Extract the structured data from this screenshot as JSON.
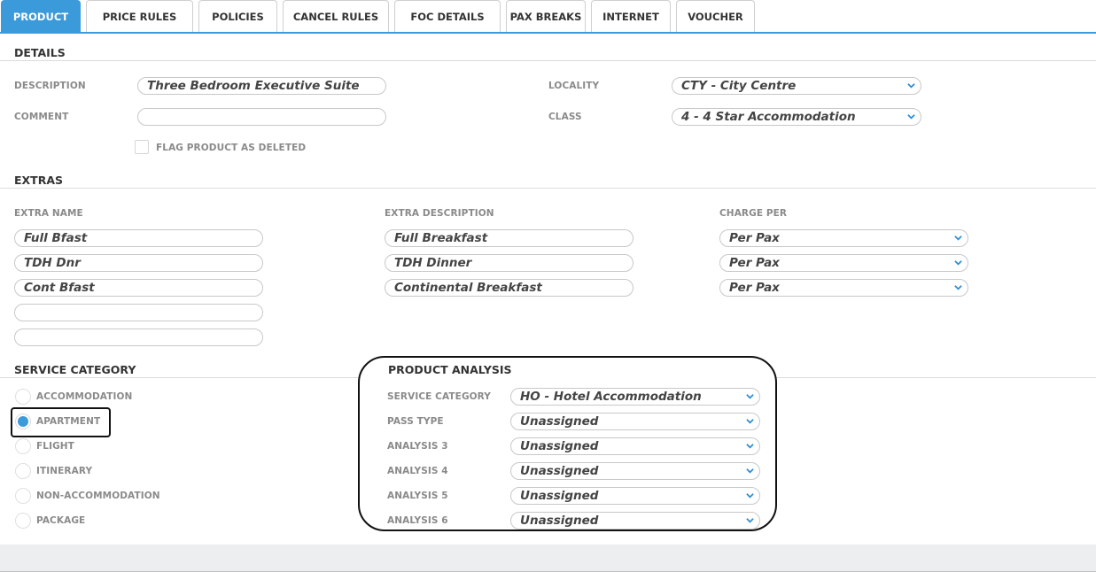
{
  "tabs": [
    {
      "label": "PRODUCT",
      "active": true
    },
    {
      "label": "PRICE RULES"
    },
    {
      "label": "POLICIES"
    },
    {
      "label": "CANCEL RULES"
    },
    {
      "label": "FOC DETAILS"
    },
    {
      "label": "PAX BREAKS"
    },
    {
      "label": "INTERNET"
    },
    {
      "label": "VOUCHER"
    }
  ],
  "details": {
    "title": "DETAILS",
    "description_label": "DESCRIPTION",
    "description_value": "Three Bedroom Executive Suite",
    "comment_label": "COMMENT",
    "comment_value": "",
    "flag_deleted_label": "FLAG PRODUCT AS DELETED",
    "flag_deleted_checked": false,
    "locality_label": "LOCALITY",
    "locality_value": "CTY - City Centre",
    "class_label": "CLASS",
    "class_value": "4 - 4 Star Accommodation"
  },
  "extras": {
    "title": "EXTRAS",
    "col_name": "EXTRA NAME",
    "col_description": "EXTRA DESCRIPTION",
    "col_charge": "CHARGE PER",
    "rows": [
      {
        "name": "Full Bfast",
        "description": "Full Breakfast",
        "charge": "Per Pax"
      },
      {
        "name": "TDH Dnr",
        "description": "TDH Dinner",
        "charge": "Per Pax"
      },
      {
        "name": "Cont Bfast",
        "description": "Continental Breakfast",
        "charge": "Per Pax"
      },
      {
        "name": ""
      },
      {
        "name": ""
      }
    ]
  },
  "service_category": {
    "title": "SERVICE CATEGORY",
    "options": [
      {
        "label": "ACCOMMODATION",
        "checked": false
      },
      {
        "label": "APARTMENT",
        "checked": true
      },
      {
        "label": "FLIGHT",
        "checked": false
      },
      {
        "label": "ITINERARY",
        "checked": false
      },
      {
        "label": "NON-ACCOMMODATION",
        "checked": false
      },
      {
        "label": "PACKAGE",
        "checked": false
      }
    ]
  },
  "product_analysis": {
    "title": "PRODUCT ANALYSIS",
    "rows": [
      {
        "label": "SERVICE CATEGORY",
        "value": "HO - Hotel Accommodation"
      },
      {
        "label": "PASS TYPE",
        "value": "Unassigned"
      },
      {
        "label": "ANALYSIS 3",
        "value": "Unassigned"
      },
      {
        "label": "ANALYSIS 4",
        "value": "Unassigned"
      },
      {
        "label": "ANALYSIS 5",
        "value": "Unassigned"
      },
      {
        "label": "ANALYSIS 6",
        "value": "Unassigned"
      }
    ]
  },
  "colors": {
    "accent": "#3b9ad9",
    "chevron": "#2e8fd6"
  },
  "icons": {
    "dropdown": "chevron-down-icon",
    "radio": "radio-button",
    "checkbox": "checkbox"
  }
}
